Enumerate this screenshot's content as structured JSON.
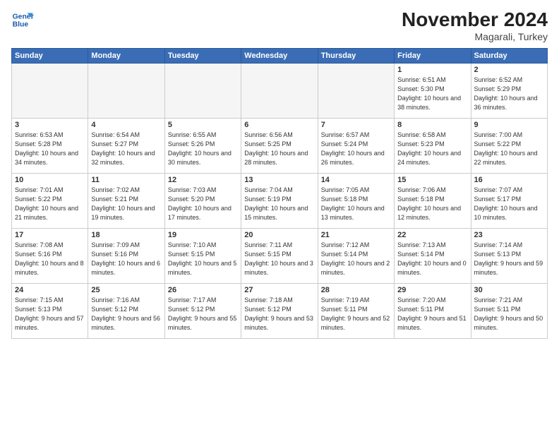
{
  "logo": {
    "line1": "General",
    "line2": "Blue"
  },
  "title": "November 2024",
  "location": "Magarali, Turkey",
  "weekdays": [
    "Sunday",
    "Monday",
    "Tuesday",
    "Wednesday",
    "Thursday",
    "Friday",
    "Saturday"
  ],
  "weeks": [
    [
      {
        "day": "",
        "info": ""
      },
      {
        "day": "",
        "info": ""
      },
      {
        "day": "",
        "info": ""
      },
      {
        "day": "",
        "info": ""
      },
      {
        "day": "",
        "info": ""
      },
      {
        "day": "1",
        "info": "Sunrise: 6:51 AM\nSunset: 5:30 PM\nDaylight: 10 hours\nand 38 minutes."
      },
      {
        "day": "2",
        "info": "Sunrise: 6:52 AM\nSunset: 5:29 PM\nDaylight: 10 hours\nand 36 minutes."
      }
    ],
    [
      {
        "day": "3",
        "info": "Sunrise: 6:53 AM\nSunset: 5:28 PM\nDaylight: 10 hours\nand 34 minutes."
      },
      {
        "day": "4",
        "info": "Sunrise: 6:54 AM\nSunset: 5:27 PM\nDaylight: 10 hours\nand 32 minutes."
      },
      {
        "day": "5",
        "info": "Sunrise: 6:55 AM\nSunset: 5:26 PM\nDaylight: 10 hours\nand 30 minutes."
      },
      {
        "day": "6",
        "info": "Sunrise: 6:56 AM\nSunset: 5:25 PM\nDaylight: 10 hours\nand 28 minutes."
      },
      {
        "day": "7",
        "info": "Sunrise: 6:57 AM\nSunset: 5:24 PM\nDaylight: 10 hours\nand 26 minutes."
      },
      {
        "day": "8",
        "info": "Sunrise: 6:58 AM\nSunset: 5:23 PM\nDaylight: 10 hours\nand 24 minutes."
      },
      {
        "day": "9",
        "info": "Sunrise: 7:00 AM\nSunset: 5:22 PM\nDaylight: 10 hours\nand 22 minutes."
      }
    ],
    [
      {
        "day": "10",
        "info": "Sunrise: 7:01 AM\nSunset: 5:22 PM\nDaylight: 10 hours\nand 21 minutes."
      },
      {
        "day": "11",
        "info": "Sunrise: 7:02 AM\nSunset: 5:21 PM\nDaylight: 10 hours\nand 19 minutes."
      },
      {
        "day": "12",
        "info": "Sunrise: 7:03 AM\nSunset: 5:20 PM\nDaylight: 10 hours\nand 17 minutes."
      },
      {
        "day": "13",
        "info": "Sunrise: 7:04 AM\nSunset: 5:19 PM\nDaylight: 10 hours\nand 15 minutes."
      },
      {
        "day": "14",
        "info": "Sunrise: 7:05 AM\nSunset: 5:18 PM\nDaylight: 10 hours\nand 13 minutes."
      },
      {
        "day": "15",
        "info": "Sunrise: 7:06 AM\nSunset: 5:18 PM\nDaylight: 10 hours\nand 12 minutes."
      },
      {
        "day": "16",
        "info": "Sunrise: 7:07 AM\nSunset: 5:17 PM\nDaylight: 10 hours\nand 10 minutes."
      }
    ],
    [
      {
        "day": "17",
        "info": "Sunrise: 7:08 AM\nSunset: 5:16 PM\nDaylight: 10 hours\nand 8 minutes."
      },
      {
        "day": "18",
        "info": "Sunrise: 7:09 AM\nSunset: 5:16 PM\nDaylight: 10 hours\nand 6 minutes."
      },
      {
        "day": "19",
        "info": "Sunrise: 7:10 AM\nSunset: 5:15 PM\nDaylight: 10 hours\nand 5 minutes."
      },
      {
        "day": "20",
        "info": "Sunrise: 7:11 AM\nSunset: 5:15 PM\nDaylight: 10 hours\nand 3 minutes."
      },
      {
        "day": "21",
        "info": "Sunrise: 7:12 AM\nSunset: 5:14 PM\nDaylight: 10 hours\nand 2 minutes."
      },
      {
        "day": "22",
        "info": "Sunrise: 7:13 AM\nSunset: 5:14 PM\nDaylight: 10 hours\nand 0 minutes."
      },
      {
        "day": "23",
        "info": "Sunrise: 7:14 AM\nSunset: 5:13 PM\nDaylight: 9 hours\nand 59 minutes."
      }
    ],
    [
      {
        "day": "24",
        "info": "Sunrise: 7:15 AM\nSunset: 5:13 PM\nDaylight: 9 hours\nand 57 minutes."
      },
      {
        "day": "25",
        "info": "Sunrise: 7:16 AM\nSunset: 5:12 PM\nDaylight: 9 hours\nand 56 minutes."
      },
      {
        "day": "26",
        "info": "Sunrise: 7:17 AM\nSunset: 5:12 PM\nDaylight: 9 hours\nand 55 minutes."
      },
      {
        "day": "27",
        "info": "Sunrise: 7:18 AM\nSunset: 5:12 PM\nDaylight: 9 hours\nand 53 minutes."
      },
      {
        "day": "28",
        "info": "Sunrise: 7:19 AM\nSunset: 5:11 PM\nDaylight: 9 hours\nand 52 minutes."
      },
      {
        "day": "29",
        "info": "Sunrise: 7:20 AM\nSunset: 5:11 PM\nDaylight: 9 hours\nand 51 minutes."
      },
      {
        "day": "30",
        "info": "Sunrise: 7:21 AM\nSunset: 5:11 PM\nDaylight: 9 hours\nand 50 minutes."
      }
    ]
  ]
}
